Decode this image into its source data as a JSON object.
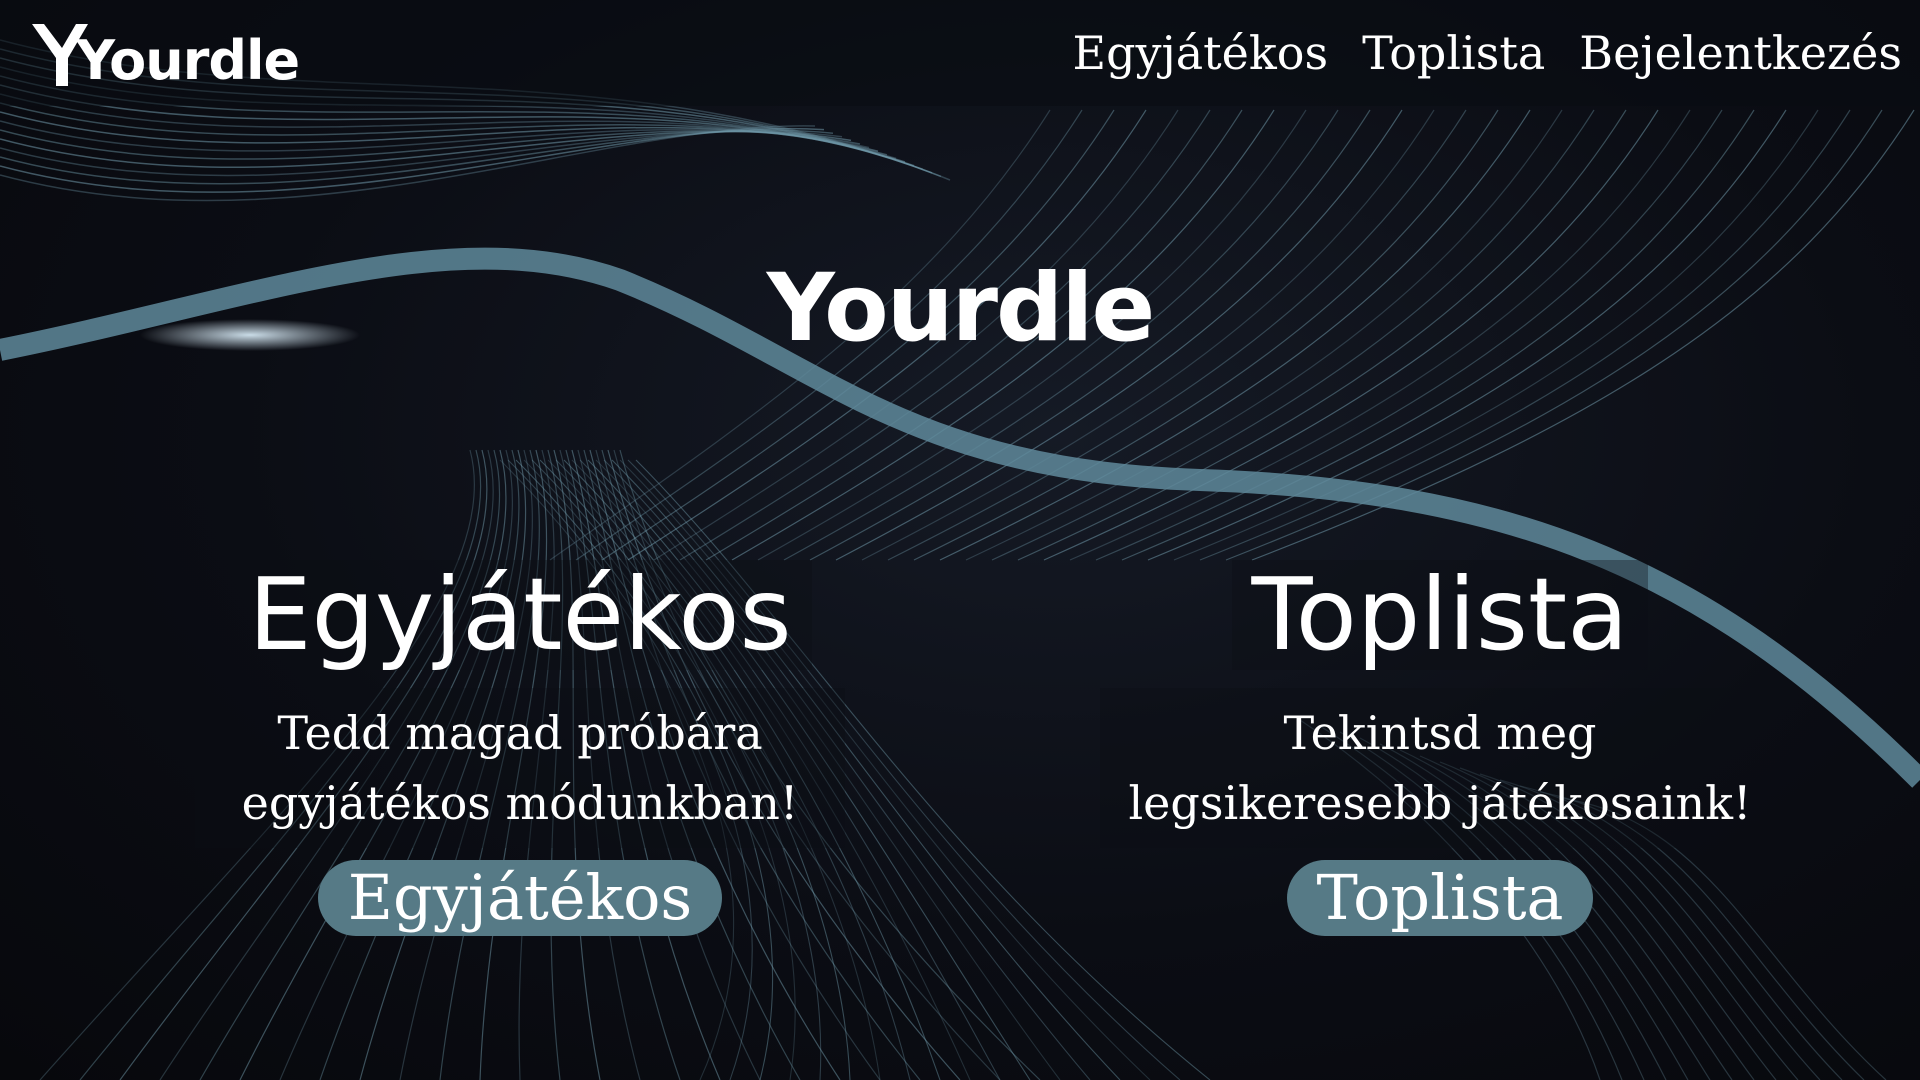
{
  "header": {
    "logo_text": "Yourdle",
    "nav": [
      {
        "label": "Egyjátékos"
      },
      {
        "label": "Toplista"
      },
      {
        "label": "Bejelentkezés"
      }
    ]
  },
  "hero": {
    "title": "Yourdle"
  },
  "cards": {
    "singleplayer": {
      "title": "Egyjátékos",
      "description": "Tedd magad próbára egyjátékos módunkban!",
      "button": "Egyjátékos"
    },
    "leaderboard": {
      "title": "Toplista",
      "description": "Tekintsd meg legsikeresebb játékosaink!",
      "button": "Toplista"
    }
  },
  "colors": {
    "background": "#0c0f16",
    "accent": "#567a86",
    "wave": "#6f98a8",
    "text": "#ffffff"
  },
  "icons": {
    "logo": "yourdle-logo-icon"
  }
}
